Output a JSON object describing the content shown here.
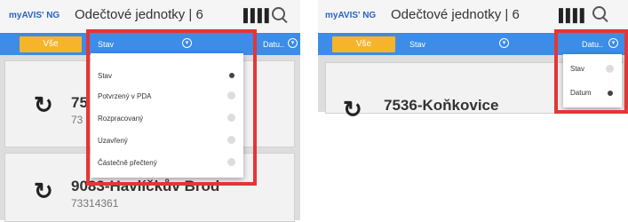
{
  "left": {
    "brand": "myAVIS' NG",
    "title": "Odečtové jednotky | 6",
    "tab_all": "Vše",
    "filter_state": "Stav",
    "filter_date": "Datu..",
    "menu_items": [
      "Stav",
      "Potvrzený v PDA",
      "Rozpracovaný",
      "Uzavřený",
      "Částečně přečtený"
    ],
    "card1_num": "75",
    "card1_sub": "73",
    "card2_num": "9083-Havlíčkův Brod",
    "card2_sub": "73314361"
  },
  "right": {
    "brand": "myAVIS' NG",
    "title": "Odečtové jednotky | 6",
    "tab_all": "Vše",
    "filter_state": "Stav",
    "filter_date": "Datu..",
    "menu_items": [
      "Stav",
      "Datum"
    ],
    "card1_num": "7536-Koňkovice"
  },
  "colors": {
    "accent": "#3c8ce8",
    "tab": "#f6b42a",
    "highlight": "#e53535"
  }
}
